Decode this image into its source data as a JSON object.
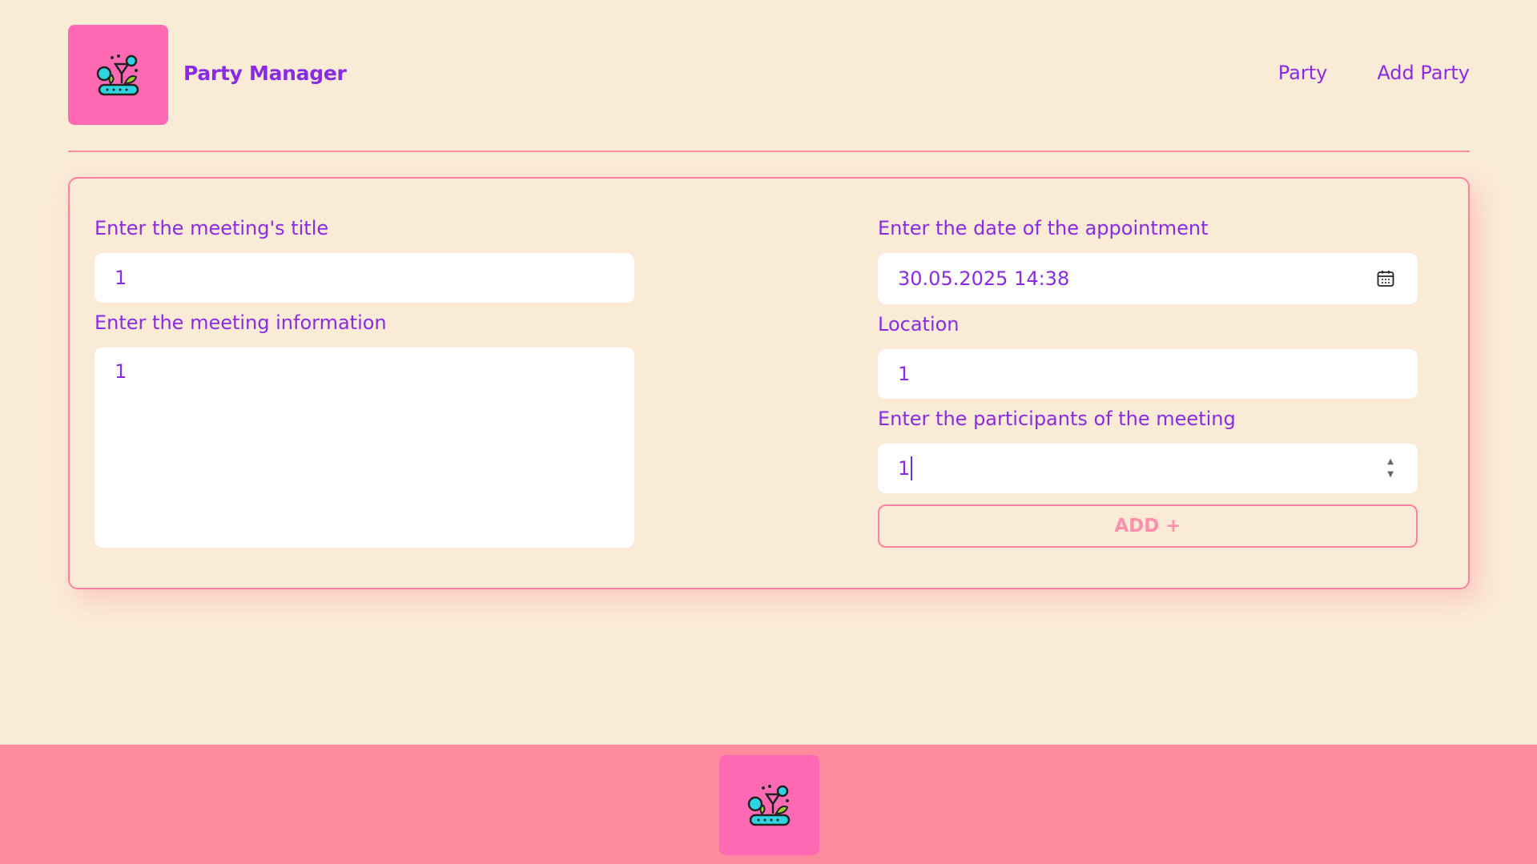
{
  "header": {
    "brand": "Party Manager",
    "nav": [
      "Party",
      "Add Party"
    ]
  },
  "form": {
    "title_label": "Enter the meeting's title",
    "title_value": "1",
    "info_label": "Enter the meeting information",
    "info_value": "1",
    "date_label": "Enter the date of the appointment",
    "date_value": "30.05.2025 14:38",
    "location_label": "Location",
    "location_value": "1",
    "participants_label": "Enter the participants of the meeting",
    "participants_value": "1",
    "add_button": "ADD +"
  },
  "icons": {
    "logo": "party-logo-icon",
    "calendar": "calendar-icon",
    "spinner": "number-spinner-icon"
  },
  "colors": {
    "background": "#faebd7",
    "accent": "#8a2be2",
    "pink": "#ff69b4",
    "footer": "#ff8c9e"
  }
}
